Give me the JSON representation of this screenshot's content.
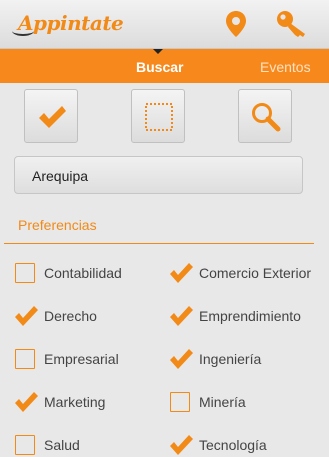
{
  "app": {
    "logo_text": "Appintate"
  },
  "colors": {
    "accent": "#f28a18",
    "tab_bg": "#f7891c"
  },
  "action_bar": {
    "icons": [
      "map-pin-icon",
      "key-icon"
    ]
  },
  "tabs": [
    {
      "label": "Buscar",
      "active": true
    },
    {
      "label": "Eventos",
      "active": false
    }
  ],
  "mode_buttons": [
    {
      "icon": "checkmark-icon"
    },
    {
      "icon": "empty-square-icon"
    },
    {
      "icon": "magnifier-icon"
    }
  ],
  "city": {
    "value": "Arequipa"
  },
  "preferences": {
    "title": "Preferencias",
    "items": [
      {
        "label": "Contabilidad",
        "checked": false
      },
      {
        "label": "Comercio Exterior",
        "checked": true
      },
      {
        "label": "Derecho",
        "checked": true
      },
      {
        "label": "Emprendimiento",
        "checked": true
      },
      {
        "label": "Empresarial",
        "checked": false
      },
      {
        "label": "Ingeniería",
        "checked": true
      },
      {
        "label": "Marketing",
        "checked": true
      },
      {
        "label": "Minería",
        "checked": false
      },
      {
        "label": "Salud",
        "checked": false
      },
      {
        "label": "Tecnología",
        "checked": true
      }
    ]
  }
}
